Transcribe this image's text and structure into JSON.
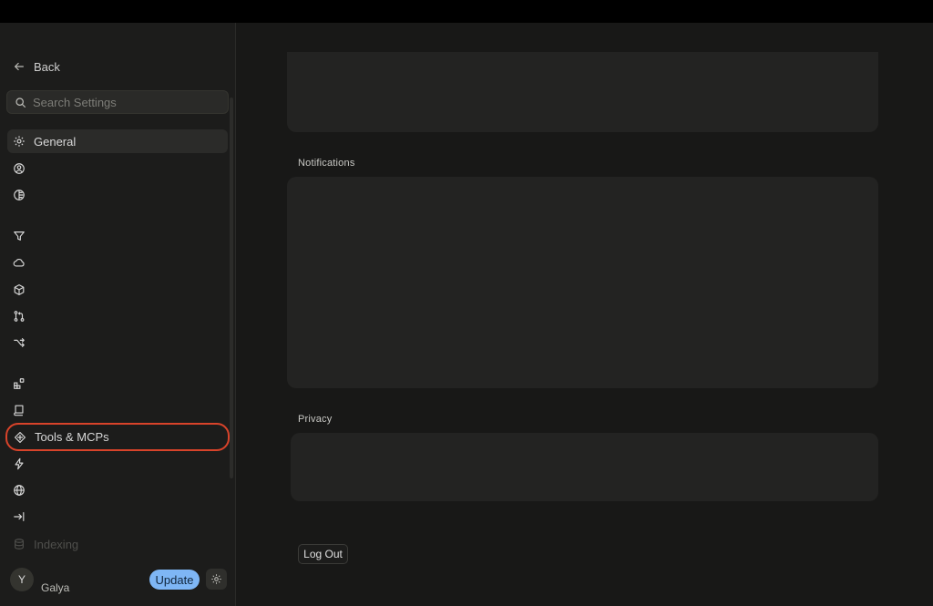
{
  "sidebar": {
    "back_label": "Back",
    "search_placeholder": "Search Settings",
    "items": [
      {
        "icon": "gear-icon",
        "label": "General"
      },
      {
        "icon": "user-circle-icon",
        "label": ""
      },
      {
        "icon": "half-circle-icon",
        "label": ""
      },
      {
        "icon": "filter-icon",
        "label": ""
      },
      {
        "icon": "cloud-icon",
        "label": ""
      },
      {
        "icon": "cube-icon",
        "label": ""
      },
      {
        "icon": "git-pull-request-icon",
        "label": ""
      },
      {
        "icon": "branch-icon",
        "label": ""
      },
      {
        "icon": "apps-icon",
        "label": ""
      },
      {
        "icon": "book-icon",
        "label": ""
      },
      {
        "icon": "tools-icon",
        "label": "Tools & MCPs"
      },
      {
        "icon": "lightning-icon",
        "label": ""
      },
      {
        "icon": "globe-icon",
        "label": ""
      },
      {
        "icon": "arrow-to-line-icon",
        "label": ""
      },
      {
        "icon": "database-icon",
        "label": "Indexing"
      }
    ],
    "user": {
      "avatar_letter": "Y",
      "name": "Galya"
    },
    "update_label": "Update"
  },
  "main": {
    "sections": [
      {
        "label": ""
      },
      {
        "label": "Notifications"
      },
      {
        "label": "Privacy"
      }
    ],
    "logout_label": "Log Out"
  },
  "colors": {
    "highlight_border": "#d8432a",
    "update_button": "#7eb6f5",
    "panel_background": "#232322"
  }
}
